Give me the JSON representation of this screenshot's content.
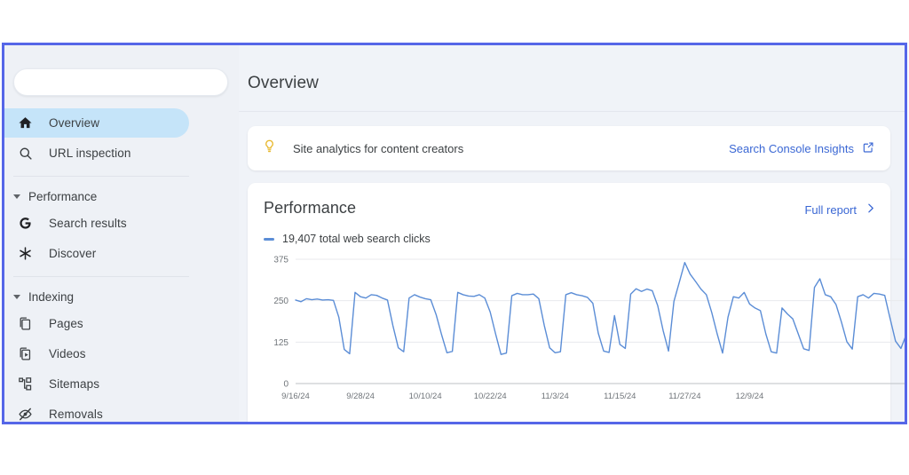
{
  "window": {
    "border_color": "#5566e8",
    "background": "#f0f3f8"
  },
  "sidebar": {
    "search": {
      "value": "",
      "placeholder": ""
    },
    "items": [
      {
        "label": "Overview",
        "icon": "home-icon",
        "active": true
      },
      {
        "label": "URL inspection",
        "icon": "search-icon",
        "active": false
      }
    ],
    "groups": [
      {
        "label": "Performance",
        "expanded": true,
        "items": [
          {
            "label": "Search results",
            "icon": "google-g-icon"
          },
          {
            "label": "Discover",
            "icon": "asterisk-icon"
          }
        ]
      },
      {
        "label": "Indexing",
        "expanded": true,
        "items": [
          {
            "label": "Pages",
            "icon": "pages-icon"
          },
          {
            "label": "Videos",
            "icon": "videos-icon"
          },
          {
            "label": "Sitemaps",
            "icon": "sitemaps-icon"
          },
          {
            "label": "Removals",
            "icon": "eye-off-icon"
          }
        ]
      }
    ]
  },
  "main": {
    "page_title": "Overview",
    "insights_card": {
      "icon": "lightbulb-icon",
      "icon_color": "#e8b931",
      "text": "Site analytics for content creators",
      "link_label": "Search Console Insights",
      "link_icon": "external-link-icon",
      "link_color": "#3a67d4"
    },
    "performance_card": {
      "title": "Performance",
      "link_label": "Full report",
      "link_icon": "chevron-right-icon",
      "link_color": "#3a67d4",
      "legend_label": "19,407 total web search clicks",
      "legend_color": "#5b8dd6"
    }
  },
  "chart_data": {
    "type": "line",
    "title": "Performance",
    "series": [
      {
        "name": "19,407 total web search clicks",
        "color": "#5b8dd6",
        "values": [
          252,
          247,
          256,
          253,
          255,
          252,
          253,
          251,
          200,
          103,
          90,
          275,
          262,
          258,
          268,
          266,
          258,
          252,
          175,
          108,
          96,
          258,
          268,
          261,
          256,
          253,
          208,
          148,
          93,
          97,
          275,
          268,
          264,
          263,
          268,
          258,
          216,
          150,
          88,
          92,
          265,
          272,
          268,
          268,
          270,
          256,
          176,
          108,
          93,
          96,
          268,
          274,
          268,
          265,
          260,
          242,
          152,
          98,
          94,
          205,
          118,
          106,
          270,
          286,
          278,
          285,
          280,
          235,
          160,
          98,
          248,
          306,
          365,
          330,
          308,
          285,
          268,
          214,
          150,
          92,
          200,
          262,
          258,
          275,
          240,
          228,
          220,
          150,
          96,
          92,
          228,
          210,
          195,
          150,
          105,
          100,
          290,
          316,
          268,
          262,
          238,
          185,
          126,
          104,
          262,
          268,
          258,
          272,
          270,
          266,
          196,
          128,
          106,
          148
        ]
      }
    ],
    "x_tick_labels": [
      "9/16/24",
      "9/28/24",
      "10/10/24",
      "10/22/24",
      "11/3/24",
      "11/15/24",
      "11/27/24",
      "12/9/24"
    ],
    "y_tick_labels": [
      "375",
      "250",
      "125",
      "0"
    ],
    "ylim": [
      0,
      375
    ],
    "y_ticks": [
      0,
      125,
      250,
      375
    ],
    "xlabel": "",
    "ylabel": "",
    "grid": true,
    "legend_position": "top-left"
  }
}
